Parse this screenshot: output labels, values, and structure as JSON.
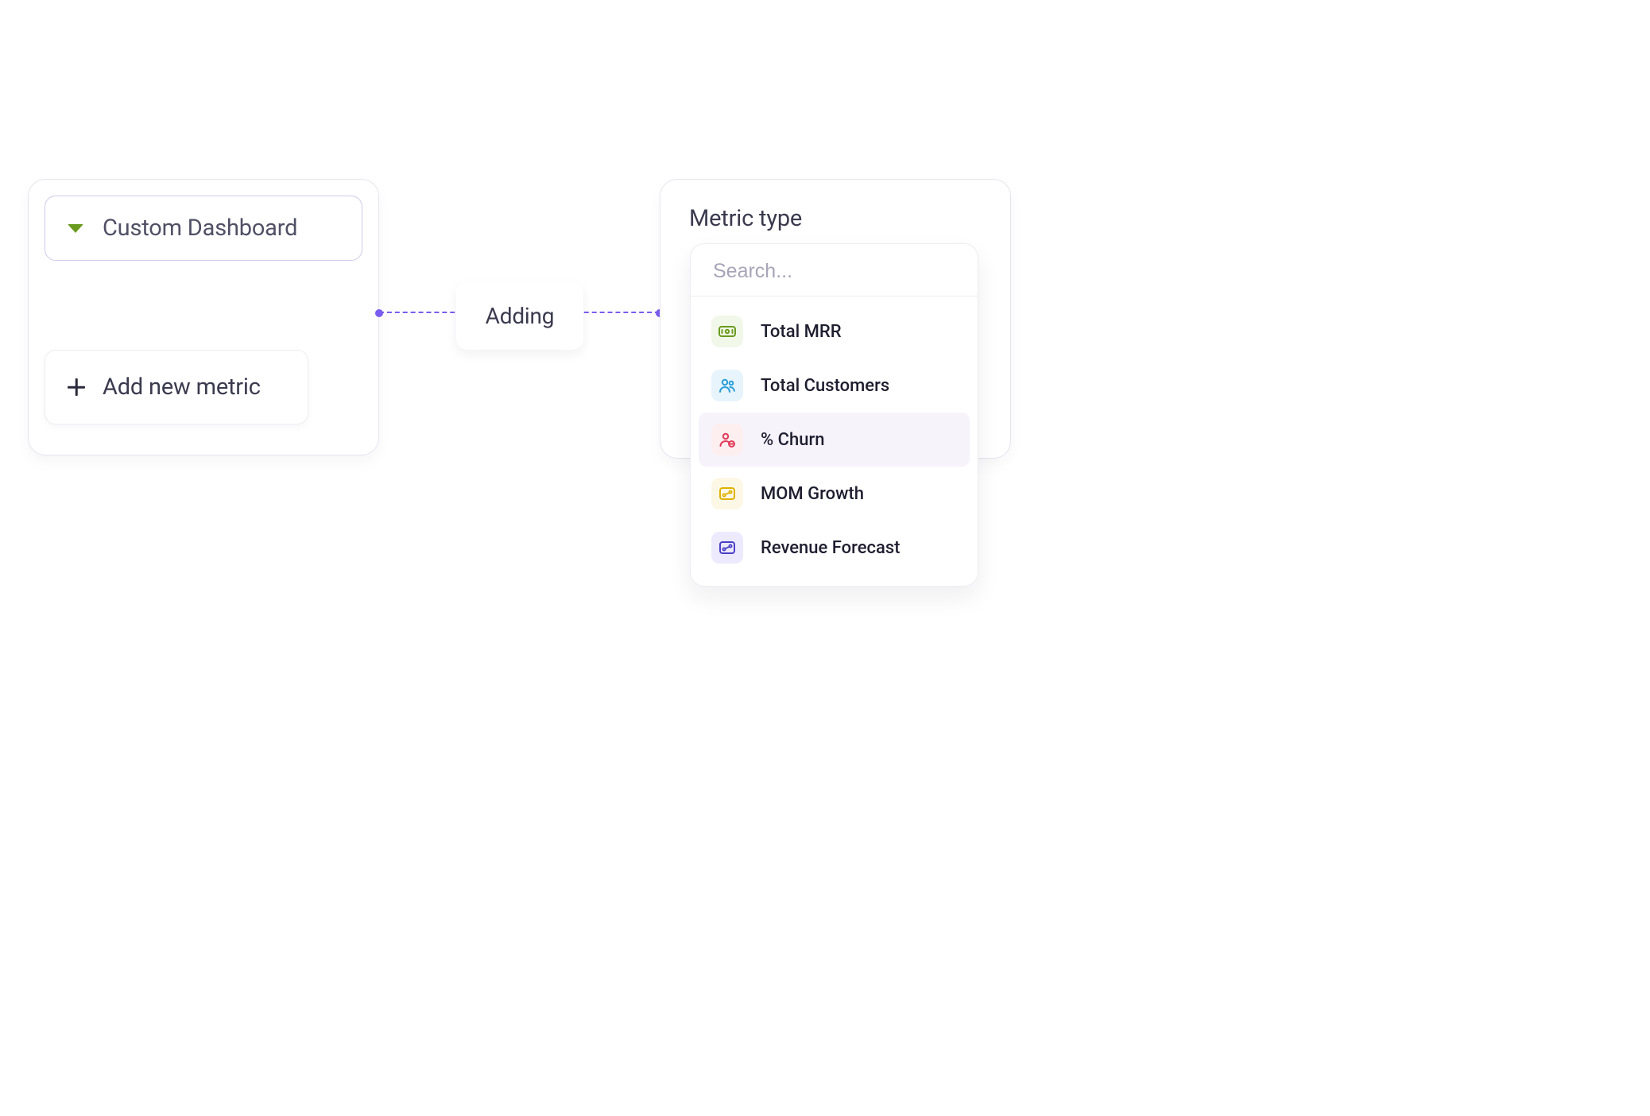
{
  "dashboard": {
    "select_label": "Custom Dashboard",
    "add_metric_label": "Add new metric"
  },
  "connector": {
    "chip_label": "Adding"
  },
  "metric_panel": {
    "title": "Metric type",
    "search_placeholder": "Search...",
    "options": [
      {
        "label": "Total MRR",
        "icon": "money-icon",
        "color": "green"
      },
      {
        "label": "Total Customers",
        "icon": "users-icon",
        "color": "blue"
      },
      {
        "label": "% Churn",
        "icon": "user-minus-icon",
        "color": "red",
        "selected": true
      },
      {
        "label": "MOM Growth",
        "icon": "growth-icon",
        "color": "yellow"
      },
      {
        "label": "Revenue Forecast",
        "icon": "forecast-icon",
        "color": "indigo"
      }
    ]
  }
}
